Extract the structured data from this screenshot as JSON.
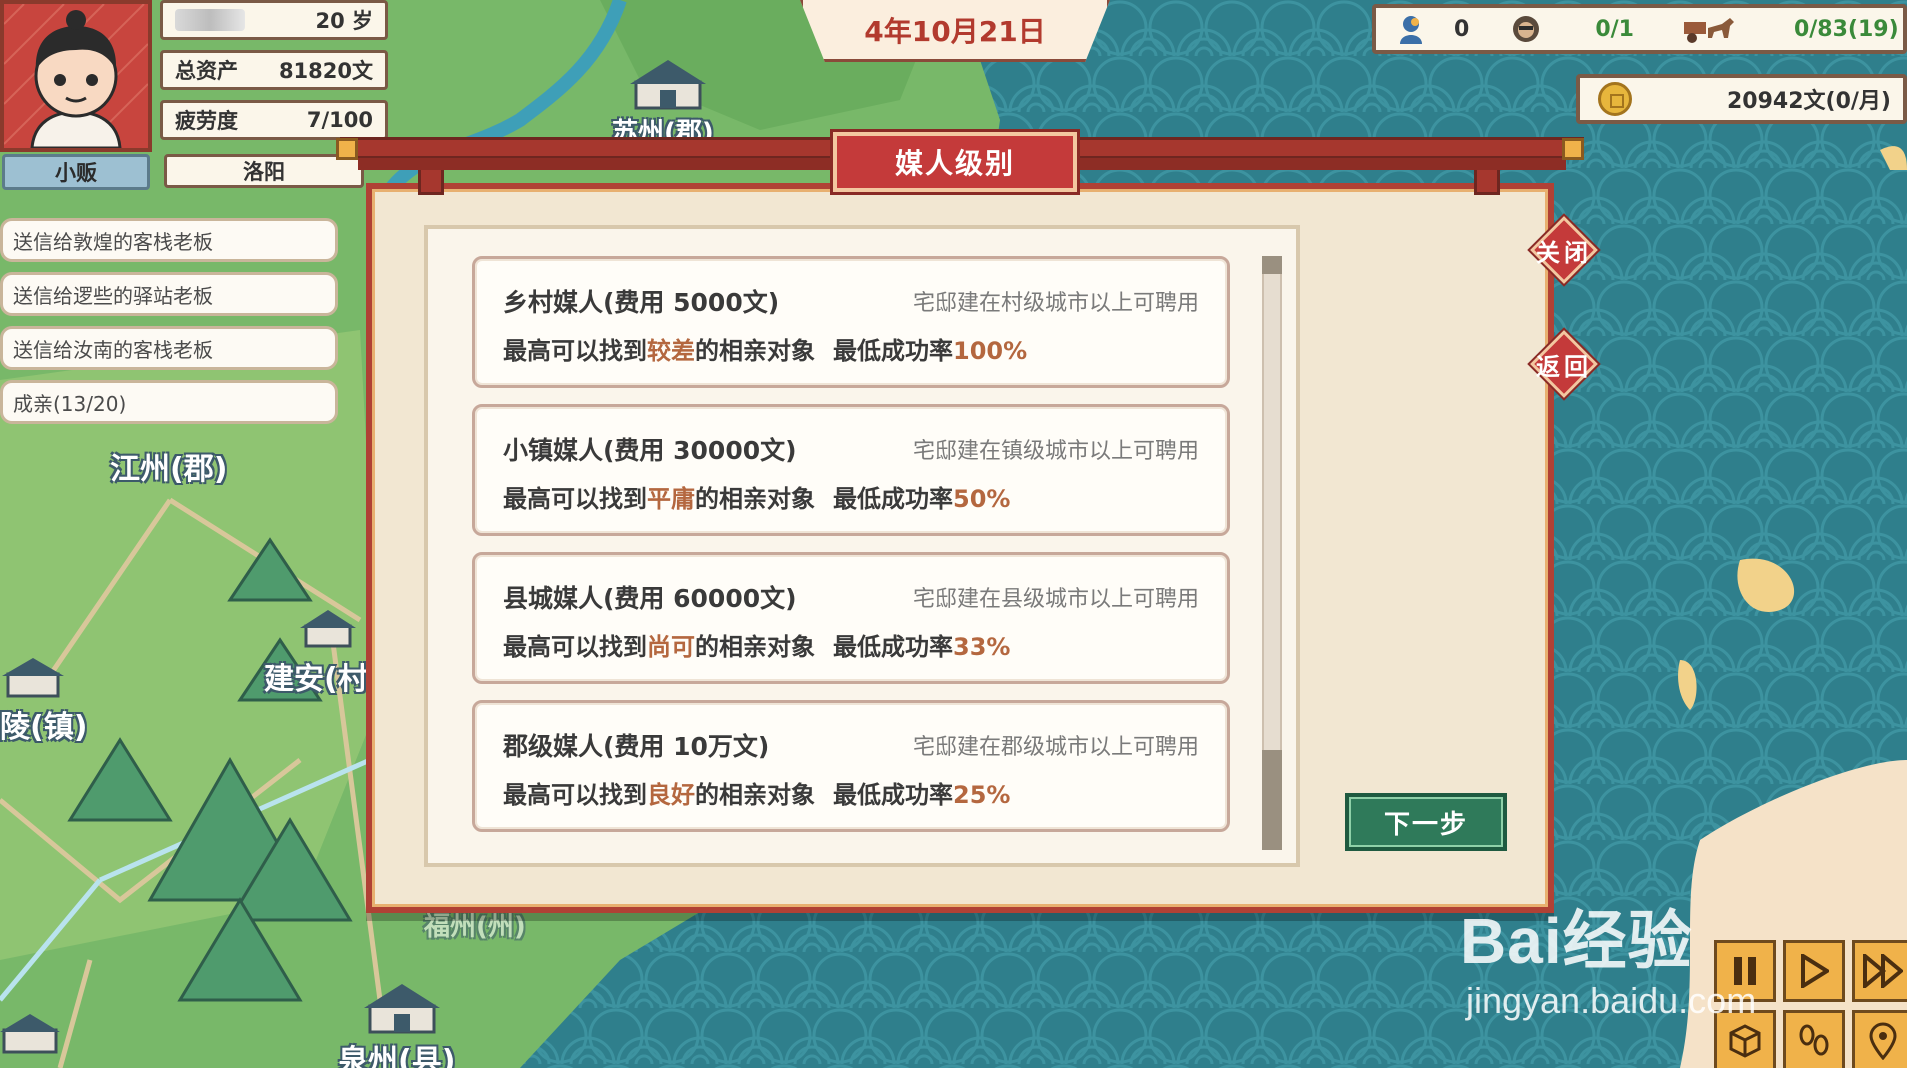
{
  "hud": {
    "age": "20 岁",
    "assets_label": "总资产",
    "assets_value": "81820文",
    "fatigue_label": "疲劳度",
    "fatigue_value": "7/100",
    "job": "小贩",
    "location": "洛阳",
    "date": "4年10月21日"
  },
  "resources": {
    "followers": "0",
    "bandits": "0/1",
    "cargo": "0/83(19)",
    "money": "20942文(0/月)"
  },
  "quests": [
    "送信给敦煌的客栈老板",
    "送信给逻些的驿站老板",
    "送信给汝南的客栈老板",
    "成亲(13/20)"
  ],
  "map_labels": {
    "jiangzhou": "江州(郡)",
    "jianan": "建安(村",
    "ling": "陵(镇)",
    "fuzhou": "福州(州)",
    "quanzhou": "泉州(县)",
    "suzhou": "苏州(郡)"
  },
  "modal": {
    "title": "媒人级别",
    "close_label": "关闭",
    "back_label": "返回",
    "next_label": "下一步",
    "find_prefix": "最高可以找到",
    "find_suffix": "的相亲对象",
    "rate_label": "最低成功率",
    "tiers": [
      {
        "name": "乡村媒人(费用 5000文)",
        "requirement": "宅邸建在村级城市以上可聘用",
        "quality": "较差",
        "rate": "100%"
      },
      {
        "name": "小镇媒人(费用 30000文)",
        "requirement": "宅邸建在镇级城市以上可聘用",
        "quality": "平庸",
        "rate": "50%"
      },
      {
        "name": "县城媒人(费用 60000文)",
        "requirement": "宅邸建在县级城市以上可聘用",
        "quality": "尚可",
        "rate": "33%"
      },
      {
        "name": "郡级媒人(费用 10万文)",
        "requirement": "宅邸建在郡级城市以上可聘用",
        "quality": "良好",
        "rate": "25%"
      }
    ]
  },
  "watermark": {
    "brand": "Bai经验",
    "url": "jingyan.baidu.com"
  },
  "colors": {
    "accent_red": "#c43a3a",
    "highlight": "#b4673f",
    "next_green": "#2f7a5a"
  }
}
